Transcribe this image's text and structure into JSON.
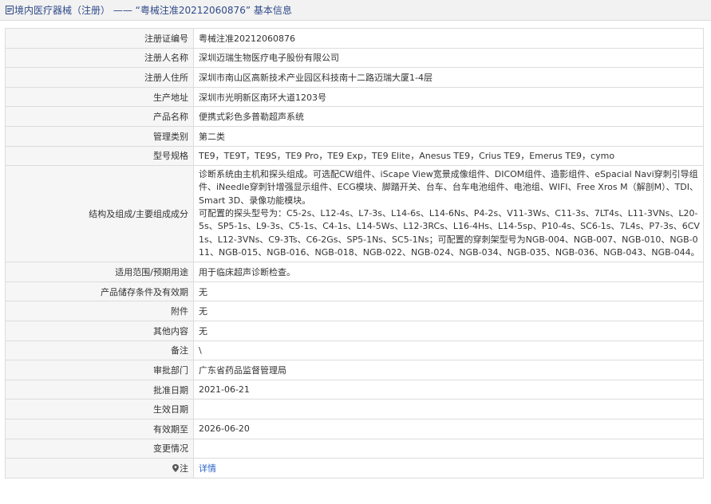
{
  "header": {
    "title": "境内医疗器械（注册） —— “粤械注准20212060876” 基本信息"
  },
  "rows": [
    {
      "label": "注册证编号",
      "value": "粤械注准20212060876"
    },
    {
      "label": "注册人名称",
      "value": "深圳迈瑞生物医疗电子股份有限公司"
    },
    {
      "label": "注册人住所",
      "value": "深圳市南山区高新技术产业园区科技南十二路迈瑞大厦1-4层"
    },
    {
      "label": "生产地址",
      "value": "深圳市光明新区南环大道1203号"
    },
    {
      "label": "产品名称",
      "value": "便携式彩色多普勒超声系统"
    },
    {
      "label": "管理类别",
      "value": "第二类"
    },
    {
      "label": "型号规格",
      "value": "TE9，TE9T，TE9S，TE9 Pro，TE9 Exp，TE9 Elite，Anesus TE9，Crius TE9，Emerus TE9，cymo"
    },
    {
      "label": "结构及组成/主要组成成分",
      "value_p1": "诊断系统由主机和探头组成。可选配CW组件、iScape View宽景成像组件、DICOM组件、造影组件、eSpacial Navi穿刺引导组件、iNeedle穿刺针增强显示组件、ECG模块、脚踏开关、台车、台车电池组件、电池组、WIFI、Free Xros M（解剖M）、TDI、Smart 3D、录像功能模块。",
      "value_p2": "可配置的探头型号为：C5-2s、L12-4s、L7-3s、L14-6s、L14-6Ns、P4-2s、V11-3Ws、C11-3s、7LT4s、L11-3VNs、L20-5s、SP5-1s、L9-3s、C5-1s、C4-1s、L14-5Ws、L12-3RCs、L16-4Hs、L14-5sp、P10-4s、SC6-1s、7L4s、P7-3s、6CV1s、L12-3VNs、C9-3Ts、C6-2Gs、SP5-1Ns、SC5-1Ns；可配置的穿刺架型号为NGB-004、NGB-007、NGB-010、NGB-011、NGB-015、NGB-016、NGB-018、NGB-022、NGB-024、NGB-034、NGB-035、NGB-036、NGB-043、NGB-044。"
    },
    {
      "label": "适用范围/预期用途",
      "value": "用于临床超声诊断检查。"
    },
    {
      "label": "产品储存条件及有效期",
      "value": "无"
    },
    {
      "label": "附件",
      "value": "无"
    },
    {
      "label": "其他内容",
      "value": "无"
    },
    {
      "label": "备注",
      "value": "\\"
    },
    {
      "label": "审批部门",
      "value": "广东省药品监督管理局"
    },
    {
      "label": "批准日期",
      "value": "2021-06-21"
    },
    {
      "label": "生效日期",
      "value": ""
    },
    {
      "label": "有效期至",
      "value": "2026-06-20"
    },
    {
      "label": "变更情况",
      "value": ""
    },
    {
      "label": "注",
      "value": "详情"
    }
  ]
}
